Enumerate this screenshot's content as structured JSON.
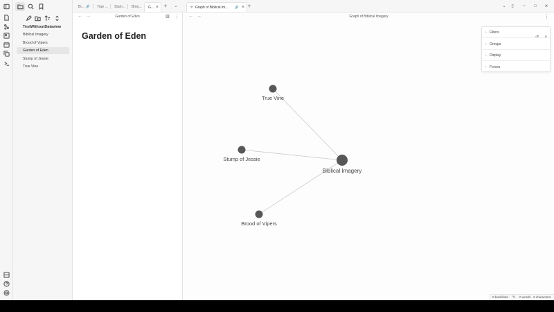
{
  "ribbon": {
    "top_icons": [
      "files-icon",
      "graph-icon",
      "canvas-icon",
      "calendar-icon",
      "copy-icon",
      "terminal-icon"
    ],
    "bottom_icons": [
      "vault-icon",
      "help-icon",
      "settings-icon"
    ]
  },
  "explorer": {
    "vault_name": "TestWithoutDataview",
    "files": [
      "Biblical Imagery",
      "Brood of Vipers",
      "Garden of Eden",
      "Stump of Jessie",
      "True Vine"
    ],
    "active_file": "Garden of Eden"
  },
  "left_tabs": [
    {
      "label": "Bi..."
    },
    {
      "label": "True ..."
    },
    {
      "label": "Stum..."
    },
    {
      "label": "Broo..."
    },
    {
      "label": "G..."
    }
  ],
  "right_tabs": [
    {
      "label": "Graph of Biblical im..."
    }
  ],
  "note": {
    "header_title": "Garden of Eden",
    "title": "Garden of Eden"
  },
  "graph": {
    "header_title": "Graph of Biblical Imagery",
    "nodes": [
      {
        "id": "true-vine",
        "label": "True Vine"
      },
      {
        "id": "stump-of-jessie",
        "label": "Stump of Jessie"
      },
      {
        "id": "biblical-imagery",
        "label": "Biblical Imagery"
      },
      {
        "id": "brood-of-vipers",
        "label": "Brood of Vipers"
      }
    ],
    "edges": [
      [
        "biblical-imagery",
        "true-vine"
      ],
      [
        "biblical-imagery",
        "stump-of-jessie"
      ],
      [
        "biblical-imagery",
        "brood-of-vipers"
      ]
    ],
    "node_color": "#575757",
    "edge_color": "#c9c9c9"
  },
  "graph_controls": {
    "sections": [
      "Filters",
      "Groups",
      "Display",
      "Forces"
    ]
  },
  "status": {
    "backlinks": "0 backlinks",
    "words": "0 words",
    "characters": "2 characters"
  }
}
